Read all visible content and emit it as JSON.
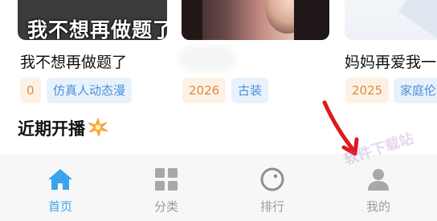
{
  "cards": [
    {
      "overlay_text": "我不想再做题了",
      "title": "我不想再做题了",
      "year": "0",
      "genre": "仿真人动态漫"
    },
    {
      "overlay_text": "",
      "title": "",
      "year": "2026",
      "genre": "古装"
    },
    {
      "overlay_text": "",
      "title": "妈妈再爱我一",
      "year": "2025",
      "genre": "家庭伦"
    }
  ],
  "section": {
    "title": "近期开播",
    "icon": "sparkle-icon"
  },
  "nav": [
    {
      "label": "首页",
      "icon": "home-icon",
      "active": true
    },
    {
      "label": "分类",
      "icon": "category-grid-icon",
      "active": false
    },
    {
      "label": "排行",
      "icon": "ranking-circle-icon",
      "active": false
    },
    {
      "label": "我的",
      "icon": "profile-icon",
      "active": false
    }
  ],
  "colors": {
    "accent": "#3aa3f0",
    "inactive": "#9a9a9a",
    "year_tag_bg": "#fdf1e6",
    "year_tag_text": "#e08a3c",
    "genre_tag_bg": "#e8f2fc",
    "genre_tag_text": "#4a90d9",
    "annotation_arrow": "#e0191c"
  }
}
